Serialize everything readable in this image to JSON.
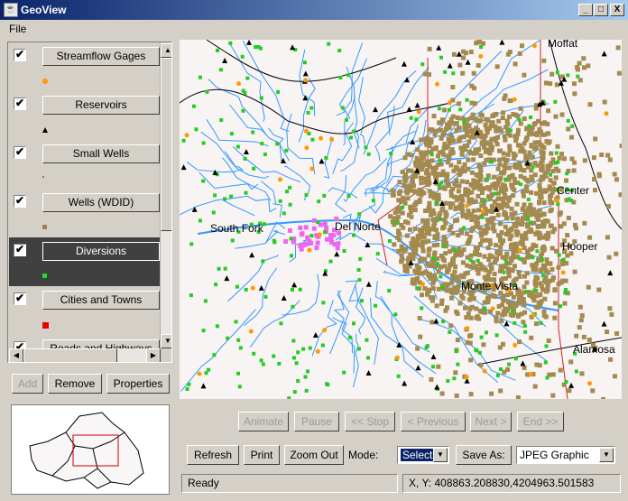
{
  "window": {
    "title": "GeoView",
    "min": "_",
    "max": "□",
    "close": "X"
  },
  "menu": {
    "file": "File"
  },
  "layers": [
    {
      "label": "Streamflow Gages",
      "checked": "✔",
      "color": "#ff9900"
    },
    {
      "label": "Reservoirs",
      "checked": "✔",
      "color": "#000000"
    },
    {
      "label": "Small Wells",
      "checked": "✔",
      "color": "#a08040"
    },
    {
      "label": "Wells (WDID)",
      "checked": "✔",
      "color": "#a08048"
    },
    {
      "label": "Diversions",
      "checked": "✔",
      "color": "#22dd22"
    },
    {
      "label": "Cities and Towns",
      "checked": "✔",
      "color": "#ee0000"
    },
    {
      "label": "Roads and Highways",
      "checked": "✔",
      "color": "#000000"
    }
  ],
  "layer_buttons": {
    "add": "Add",
    "remove": "Remove",
    "properties": "Properties"
  },
  "map_labels": {
    "north": "Moffat",
    "southfork": "South Fork",
    "delnorte": "Del Norte",
    "center": "Center",
    "hooper": "Hooper",
    "monte": "Monte Vista",
    "alamosa": "Alamosa"
  },
  "animation": {
    "animate": "Animate",
    "pause": "Pause",
    "stop": "<< Stop",
    "previous": "< Previous",
    "next": "Next >",
    "end": "End >>"
  },
  "toolbar": {
    "refresh": "Refresh",
    "print": "Print",
    "zoom_out": "Zoom Out",
    "mode_label": "Mode:",
    "mode_value": "Select",
    "save_as": "Save As:",
    "format": "JPEG Graphic"
  },
  "status": {
    "text": "Ready",
    "coords": "X, Y:  408863.208830,4204963.501583"
  }
}
